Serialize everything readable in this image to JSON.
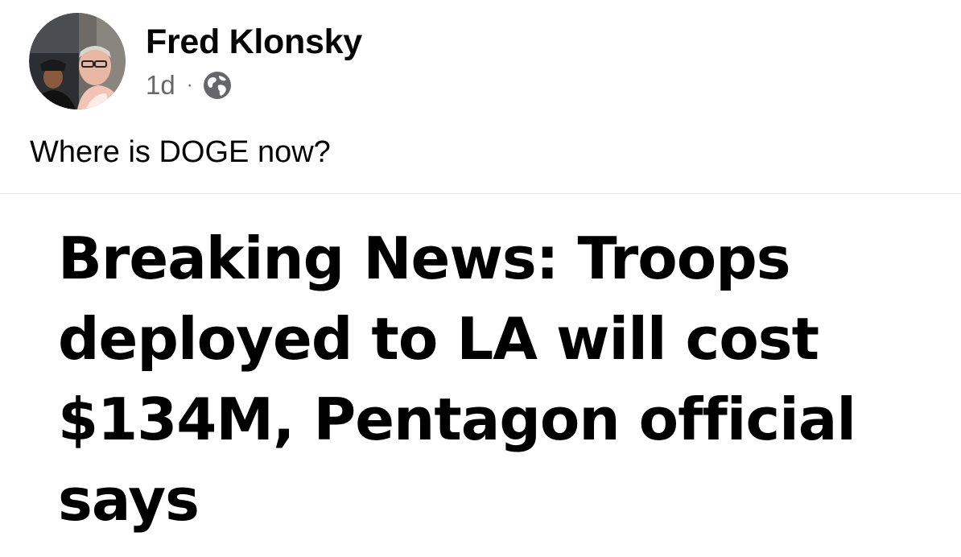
{
  "post": {
    "author": {
      "name": "Fred Klonsky",
      "avatar_icon": "profile-photo"
    },
    "timestamp": "1d",
    "separator": "·",
    "audience_icon": "globe-icon",
    "text": "Where is DOGE now?"
  },
  "attachment": {
    "headline_lines": [
      "Breaking News: Troops",
      "deployed to LA will cost",
      "$134M, Pentagon official",
      "says"
    ]
  },
  "colors": {
    "primary_text": "#050505",
    "secondary_text": "#65676b",
    "divider": "#e4e6eb",
    "headline_text": "#000000"
  }
}
